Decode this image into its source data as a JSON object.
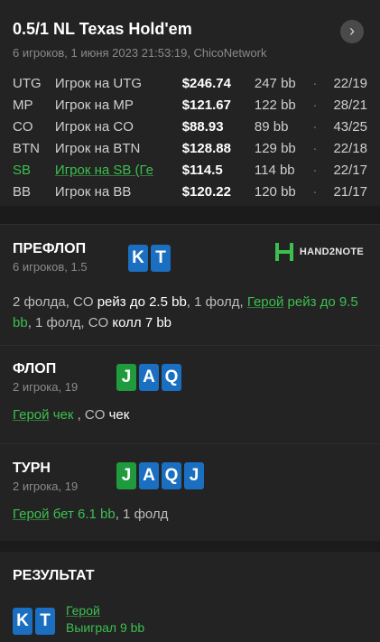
{
  "header": {
    "title": "0.5/1 NL Texas Hold'em",
    "subtitle": "6 игроков, 1 июня 2023 21:53:19, ChicoNetwork",
    "nav_icon": "chevron-right-icon"
  },
  "players": [
    {
      "pos": "UTG",
      "name": "Игрок на UTG",
      "money": "$246.74",
      "bb": "247 bb",
      "stat": "22/19"
    },
    {
      "pos": "MP",
      "name": "Игрок на MP",
      "money": "$121.67",
      "bb": "122 bb",
      "stat": "28/21"
    },
    {
      "pos": "CO",
      "name": "Игрок на CO",
      "money": "$88.93",
      "bb": "89 bb",
      "stat": "43/25"
    },
    {
      "pos": "BTN",
      "name": "Игрок на BTN",
      "money": "$128.88",
      "bb": "129 bb",
      "stat": "22/18"
    },
    {
      "pos": "SB",
      "name": "Игрок на SB (Ге",
      "money": "$114.5",
      "bb": "114 bb",
      "stat": "22/17"
    },
    {
      "pos": "BB",
      "name": "Игрок на BB",
      "money": "$120.22",
      "bb": "120 bb",
      "stat": "21/17"
    }
  ],
  "dot": "·",
  "preflop": {
    "title": "ПРЕФЛОП",
    "sub": "6 игроков, 1.5",
    "cards": [
      "K",
      "T"
    ],
    "logo": "HAND2NOTE",
    "a1": "2 фолда, CO ",
    "a2": "рейз до 2.5 bb",
    "a3": ", 1 фолд, ",
    "a4": "Герой",
    "a5": " рейз до 9.5 bb",
    "a6": ", 1 фолд, CO ",
    "a7": "колл 7 bb"
  },
  "flop": {
    "title": "ФЛОП",
    "sub": "2 игрока, 19",
    "cards": [
      "J",
      "A",
      "Q"
    ],
    "a1": "Герой",
    "a2": " чек",
    "a3": " , CO ",
    "a4": "чек"
  },
  "turn": {
    "title": "ТУРН",
    "sub": "2 игрока, 19",
    "cards": [
      "J",
      "A",
      "Q",
      "J"
    ],
    "a1": "Герой",
    "a2": " бет 6.1 bb",
    "a3": ", 1 фолд"
  },
  "result": {
    "title": "РЕЗУЛЬТАТ",
    "cards": [
      "K",
      "T"
    ],
    "hero": "Герой",
    "won": "Выиграл 9 bb"
  },
  "colors": {
    "accent_green": "#3cbf4f",
    "card_blue": "#1b6fc0",
    "card_green": "#1f9a3c"
  }
}
